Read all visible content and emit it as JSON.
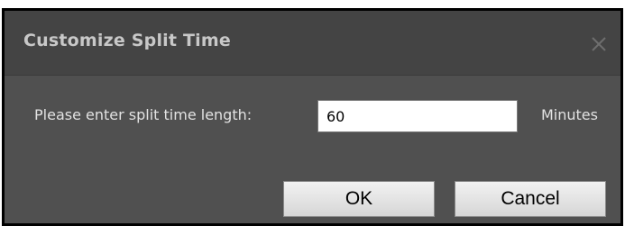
{
  "dialog": {
    "title": "Customize Split Time",
    "close_icon": "close-icon",
    "prompt_label": "Please enter split time length:",
    "input_value": "60",
    "unit_label": "Minutes",
    "ok_label": "OK",
    "cancel_label": "Cancel"
  },
  "colors": {
    "titlebar": "#444444",
    "body": "#505050",
    "title_text": "#c8c8c8",
    "label_text": "#e2e2e2"
  }
}
